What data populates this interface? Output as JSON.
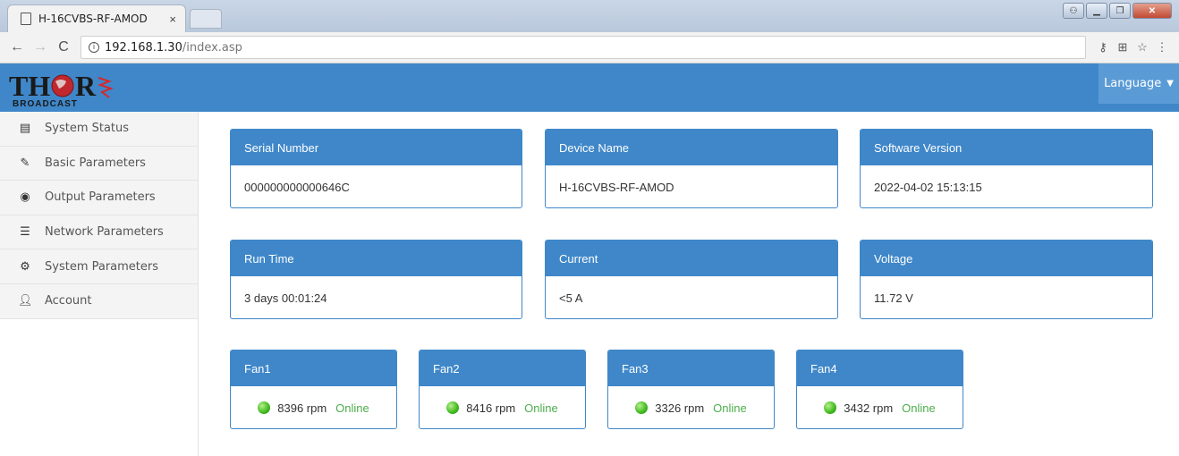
{
  "browser": {
    "tab_title": "H-16CVBS-RF-AMOD",
    "tab_close": "×",
    "url_host": "192.168.1.30",
    "url_path": "/index.asp"
  },
  "header": {
    "logo_word": "THOR",
    "logo_sub": "BROADCAST",
    "language_label": "Language"
  },
  "sidebar": {
    "items": [
      {
        "label": "System Status",
        "icon": "list-icon"
      },
      {
        "label": "Basic Parameters",
        "icon": "pencil-icon"
      },
      {
        "label": "Output Parameters",
        "icon": "dashboard-icon"
      },
      {
        "label": "Network Parameters",
        "icon": "menu-icon"
      },
      {
        "label": "System Parameters",
        "icon": "gear-icon"
      },
      {
        "label": "Account",
        "icon": "user-icon"
      }
    ]
  },
  "status": {
    "serial_number": {
      "label": "Serial Number",
      "value": "000000000000646C"
    },
    "device_name": {
      "label": "Device Name",
      "value": "H-16CVBS-RF-AMOD"
    },
    "software_version": {
      "label": "Software Version",
      "value": "2022-04-02 15:13:15"
    },
    "run_time": {
      "label": "Run Time",
      "value": "3 days 00:01:24"
    },
    "current": {
      "label": "Current",
      "value": "<5 A"
    },
    "voltage": {
      "label": "Voltage",
      "value": "11.72 V"
    }
  },
  "fans": [
    {
      "label": "Fan1",
      "rpm": "8396 rpm",
      "state": "Online"
    },
    {
      "label": "Fan2",
      "rpm": "8416 rpm",
      "state": "Online"
    },
    {
      "label": "Fan3",
      "rpm": "3326 rpm",
      "state": "Online"
    },
    {
      "label": "Fan4",
      "rpm": "3432 rpm",
      "state": "Online"
    }
  ],
  "colors": {
    "primary": "#3f87c9",
    "online": "#4cae4c"
  }
}
